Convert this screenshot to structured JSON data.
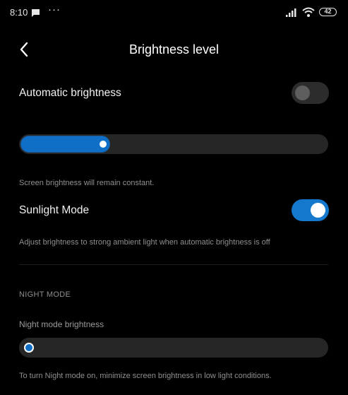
{
  "status_bar": {
    "time": "8:10",
    "more_indicator": "···",
    "battery_level": "42",
    "icons": [
      "message-icon",
      "signal-icon",
      "wifi-icon",
      "battery-icon"
    ]
  },
  "header": {
    "title": "Brightness level",
    "back_icon": "chevron-left-icon"
  },
  "automatic_brightness": {
    "label": "Automatic brightness",
    "enabled": false
  },
  "brightness_slider": {
    "level_fraction": 0.29
  },
  "brightness_caption": "Screen brightness will remain constant.",
  "sunlight_mode": {
    "label": "Sunlight Mode",
    "enabled": true,
    "description": "Adjust brightness to strong ambient light when automatic brightness is off"
  },
  "night_mode": {
    "section_title": "NIGHT MODE",
    "brightness_label": "Night mode brightness",
    "brightness_fraction": 0.0,
    "caption": "To turn Night mode on, minimize screen brightness in low light conditions."
  },
  "colors": {
    "background": "#000000",
    "accent": "#1478cc",
    "track": "#262626",
    "caption_text": "#8f8f8f"
  }
}
